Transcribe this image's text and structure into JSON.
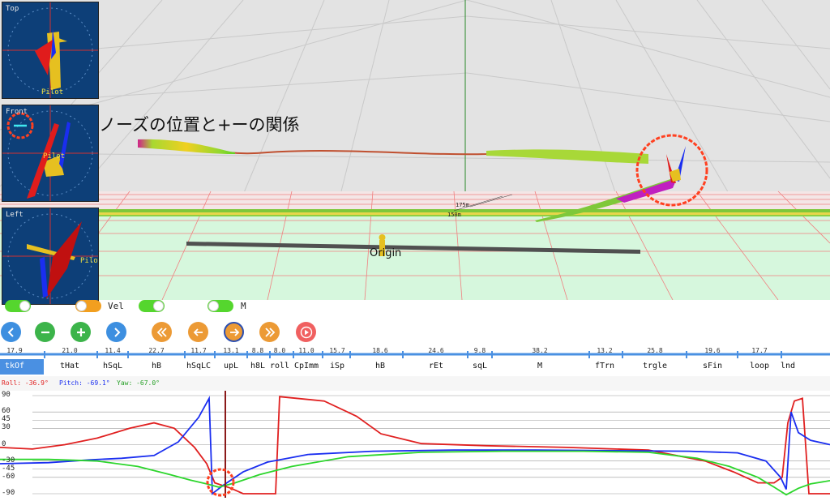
{
  "scene": {
    "annotation": "ノーズの位置と+ーの関係",
    "origin_label": "Origin",
    "distance_labels": [
      "175m",
      "150m"
    ]
  },
  "views": [
    {
      "label": "Top",
      "pilot": "Pilot"
    },
    {
      "label": "Front",
      "pilot": "Pilot"
    },
    {
      "label": "Left",
      "pilot": "Pilot"
    }
  ],
  "toggles": [
    {
      "color": "#55d62e",
      "state": "on",
      "label": ""
    },
    {
      "color": "#f29f1f",
      "state": "off",
      "label": "Vel"
    },
    {
      "color": "#55d62e",
      "state": "on",
      "label": ""
    },
    {
      "color": "#55d62e",
      "state": "off",
      "label": "M"
    }
  ],
  "buttons": [
    {
      "name": "prev-button",
      "icon": "chevron-left-icon",
      "color": "#3d8fe0"
    },
    {
      "name": "minus-button",
      "icon": "minus-icon",
      "color": "#3cb44a"
    },
    {
      "name": "plus-button",
      "icon": "plus-icon",
      "color": "#3cb44a"
    },
    {
      "name": "next-button",
      "icon": "chevron-right-icon",
      "color": "#3d8fe0"
    },
    {
      "name": "rewind-button",
      "icon": "double-left-icon",
      "color": "#ec9a35"
    },
    {
      "name": "step-back-button",
      "icon": "arrow-left-icon",
      "color": "#ec9a35"
    },
    {
      "name": "step-forward-button",
      "icon": "arrow-right-icon",
      "color": "#ec9a35"
    },
    {
      "name": "fast-forward-button",
      "icon": "double-right-icon",
      "color": "#ec9a35"
    },
    {
      "name": "play-button",
      "icon": "play-icon",
      "color": "#f06060"
    }
  ],
  "segments": [
    {
      "name": "tkOf",
      "value": "17.9"
    },
    {
      "name": "tHat",
      "value": "21.0"
    },
    {
      "name": "hSqL",
      "value": "11.4"
    },
    {
      "name": "hB",
      "value": "22.7"
    },
    {
      "name": "hSqLC",
      "value": "11.7"
    },
    {
      "name": "upL",
      "value": "13.1"
    },
    {
      "name": "h8L",
      "value": "8.8"
    },
    {
      "name": "roll",
      "value": "8.0"
    },
    {
      "name": "CpImm",
      "value": "11.0"
    },
    {
      "name": "iSp",
      "value": "15.7"
    },
    {
      "name": "hB",
      "value": "18.6"
    },
    {
      "name": "rEt",
      "value": "24.6"
    },
    {
      "name": "sqL",
      "value": "9.8"
    },
    {
      "name": "M",
      "value": "38.2"
    },
    {
      "name": "fTrn",
      "value": "13.2"
    },
    {
      "name": "trgle",
      "value": "25.8"
    },
    {
      "name": "sFin",
      "value": "19.6"
    },
    {
      "name": "loop",
      "value": "17.7"
    },
    {
      "name": "lnd",
      "value": ""
    }
  ],
  "readouts": {
    "roll": "Roll: -36.9°",
    "pitch": "Pitch: -69.1°",
    "yaw": "Yaw: -67.0°"
  },
  "chart_data": {
    "type": "line",
    "ylim": [
      -90,
      90
    ],
    "yticks": [
      "90",
      "60",
      "45",
      "30",
      "0",
      "-30",
      "-45",
      "-60",
      "-90"
    ],
    "series": [
      {
        "color": "#e02020",
        "x": [
          0,
          40,
          80,
          120,
          160,
          190,
          215,
          240,
          255,
          265,
          285,
          300,
          325,
          340,
          345,
          400,
          440,
          470,
          520,
          600,
          700,
          800,
          870,
          905,
          935,
          955,
          965,
          972,
          980,
          990,
          998,
          1024
        ],
        "y": [
          -5,
          -8,
          0,
          12,
          30,
          40,
          30,
          -5,
          -35,
          -70,
          -80,
          -90,
          -90,
          -90,
          88,
          80,
          52,
          20,
          2,
          -2,
          -5,
          -10,
          -30,
          -50,
          -70,
          -70,
          -60,
          40,
          80,
          85,
          -90,
          -90
        ]
      },
      {
        "color": "#1a2ef0",
        "x": [
          0,
          60,
          110,
          150,
          190,
          220,
          245,
          258,
          262,
          275,
          300,
          330,
          380,
          460,
          560,
          660,
          760,
          850,
          910,
          945,
          963,
          970,
          976,
          985,
          1000,
          1024
        ],
        "y": [
          -35,
          -33,
          -28,
          -25,
          -20,
          5,
          50,
          85,
          -90,
          -75,
          -50,
          -32,
          -18,
          -12,
          -10,
          -10,
          -11,
          -12,
          -15,
          -30,
          -60,
          -82,
          60,
          22,
          8,
          0
        ]
      },
      {
        "color": "#2cd62c",
        "x": [
          0,
          60,
          120,
          170,
          210,
          235,
          255,
          270,
          290,
          320,
          360,
          430,
          520,
          620,
          720,
          800,
          860,
          900,
          935,
          955,
          970,
          985,
          1000,
          1024
        ],
        "y": [
          -27,
          -27,
          -30,
          -40,
          -55,
          -65,
          -72,
          -78,
          -70,
          -55,
          -40,
          -22,
          -14,
          -12,
          -12,
          -14,
          -25,
          -40,
          -60,
          -78,
          -92,
          -80,
          -72,
          -66
        ]
      }
    ]
  }
}
